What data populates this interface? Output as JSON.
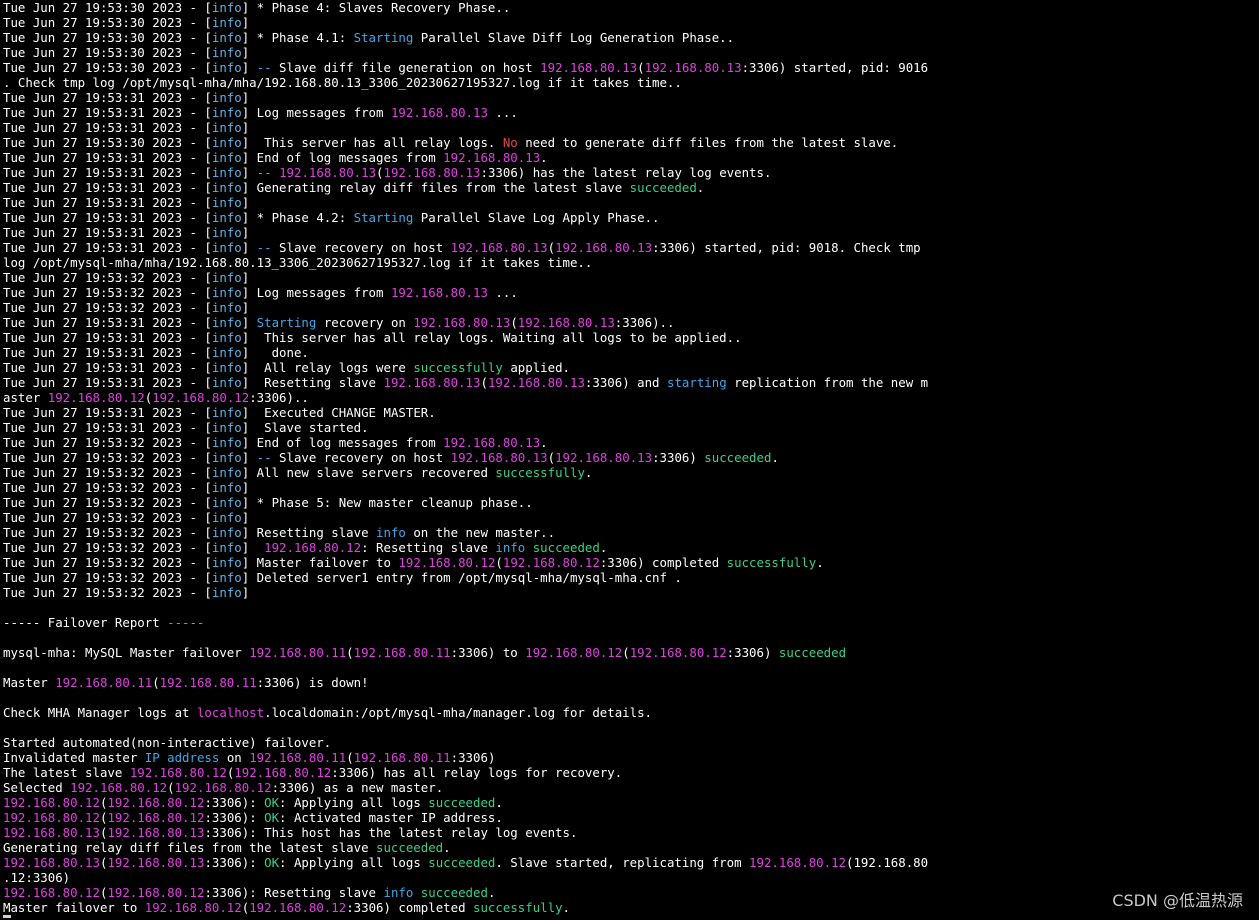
{
  "colors": {
    "default": "#ffffff",
    "m": "#e040e0",
    "g": "#3ccf86",
    "c": "#42a6e8",
    "r": "#e04848",
    "level": "#5fb3e6"
  },
  "watermark": "CSDN @低温热源",
  "lines": [
    {
      "ts": "Tue Jun 27 19:53:30 2023",
      "segs": [
        [
          "w",
          " * Phase 4: Slaves Recovery Phase.."
        ]
      ]
    },
    {
      "ts": "Tue Jun 27 19:53:30 2023",
      "segs": []
    },
    {
      "ts": "Tue Jun 27 19:53:30 2023",
      "segs": [
        [
          "w",
          " * Phase 4.1: "
        ],
        [
          "c",
          "Starting"
        ],
        [
          "w",
          " Parallel Slave Diff Log Generation Phase.."
        ]
      ]
    },
    {
      "ts": "Tue Jun 27 19:53:30 2023",
      "segs": []
    },
    {
      "ts": "Tue Jun 27 19:53:30 2023",
      "segs": [
        [
          "w",
          " "
        ],
        [
          "c",
          "--"
        ],
        [
          "w",
          " Slave diff file generation on host "
        ],
        [
          "m",
          "192.168.80.13"
        ],
        [
          "w",
          "("
        ],
        [
          "m",
          "192.168.80.13"
        ],
        [
          "w",
          ":3306) started, pid: 9016"
        ]
      ]
    },
    {
      "segs": [
        [
          "w",
          ". Check tmp log /opt/mysql-mha/mha/192.168.80.13_3306_20230627195327.log if it takes time.."
        ]
      ]
    },
    {
      "ts": "Tue Jun 27 19:53:31 2023",
      "segs": []
    },
    {
      "ts": "Tue Jun 27 19:53:31 2023",
      "segs": [
        [
          "w",
          " Log messages from "
        ],
        [
          "m",
          "192.168.80.13"
        ],
        [
          "w",
          " ..."
        ]
      ]
    },
    {
      "ts": "Tue Jun 27 19:53:31 2023",
      "segs": []
    },
    {
      "ts": "Tue Jun 27 19:53:30 2023",
      "segs": [
        [
          "w",
          "  This server has all relay logs. "
        ],
        [
          "r",
          "No"
        ],
        [
          "w",
          " need to generate diff files from the latest slave."
        ]
      ]
    },
    {
      "ts": "Tue Jun 27 19:53:31 2023",
      "segs": [
        [
          "w",
          " End of log messages from "
        ],
        [
          "m",
          "192.168.80.13"
        ],
        [
          "w",
          "."
        ]
      ]
    },
    {
      "ts": "Tue Jun 27 19:53:31 2023",
      "segs": [
        [
          "w",
          " "
        ],
        [
          "c",
          "--"
        ],
        [
          "w",
          " "
        ],
        [
          "m",
          "192.168.80.13"
        ],
        [
          "w",
          "("
        ],
        [
          "m",
          "192.168.80.13"
        ],
        [
          "w",
          ":3306) has the latest relay log events."
        ]
      ]
    },
    {
      "ts": "Tue Jun 27 19:53:31 2023",
      "segs": [
        [
          "w",
          " Generating relay diff files from the latest slave "
        ],
        [
          "g",
          "succeeded"
        ],
        [
          "w",
          "."
        ]
      ]
    },
    {
      "ts": "Tue Jun 27 19:53:31 2023",
      "segs": []
    },
    {
      "ts": "Tue Jun 27 19:53:31 2023",
      "segs": [
        [
          "w",
          " * Phase 4.2: "
        ],
        [
          "c",
          "Starting"
        ],
        [
          "w",
          " Parallel Slave Log Apply Phase.."
        ]
      ]
    },
    {
      "ts": "Tue Jun 27 19:53:31 2023",
      "segs": []
    },
    {
      "ts": "Tue Jun 27 19:53:31 2023",
      "segs": [
        [
          "w",
          " "
        ],
        [
          "c",
          "--"
        ],
        [
          "w",
          " Slave recovery on host "
        ],
        [
          "m",
          "192.168.80.13"
        ],
        [
          "w",
          "("
        ],
        [
          "m",
          "192.168.80.13"
        ],
        [
          "w",
          ":3306) started, pid: 9018. Check tmp"
        ]
      ]
    },
    {
      "segs": [
        [
          "w",
          "log /opt/mysql-mha/mha/192.168.80.13_3306_20230627195327.log if it takes time.."
        ]
      ]
    },
    {
      "ts": "Tue Jun 27 19:53:32 2023",
      "segs": []
    },
    {
      "ts": "Tue Jun 27 19:53:32 2023",
      "segs": [
        [
          "w",
          " Log messages from "
        ],
        [
          "m",
          "192.168.80.13"
        ],
        [
          "w",
          " ..."
        ]
      ]
    },
    {
      "ts": "Tue Jun 27 19:53:32 2023",
      "segs": []
    },
    {
      "ts": "Tue Jun 27 19:53:31 2023",
      "segs": [
        [
          "w",
          " "
        ],
        [
          "c",
          "Starting"
        ],
        [
          "w",
          " recovery on "
        ],
        [
          "m",
          "192.168.80.13"
        ],
        [
          "w",
          "("
        ],
        [
          "m",
          "192.168.80.13"
        ],
        [
          "w",
          ":3306).."
        ]
      ]
    },
    {
      "ts": "Tue Jun 27 19:53:31 2023",
      "segs": [
        [
          "w",
          "  This server has all relay logs. Waiting all logs to be applied.."
        ]
      ]
    },
    {
      "ts": "Tue Jun 27 19:53:31 2023",
      "segs": [
        [
          "w",
          "   done."
        ]
      ]
    },
    {
      "ts": "Tue Jun 27 19:53:31 2023",
      "segs": [
        [
          "w",
          "  All relay logs were "
        ],
        [
          "g",
          "successfully"
        ],
        [
          "w",
          " applied."
        ]
      ]
    },
    {
      "ts": "Tue Jun 27 19:53:31 2023",
      "segs": [
        [
          "w",
          "  Resetting slave "
        ],
        [
          "m",
          "192.168.80.13"
        ],
        [
          "w",
          "("
        ],
        [
          "m",
          "192.168.80.13"
        ],
        [
          "w",
          ":3306) and "
        ],
        [
          "c",
          "starting"
        ],
        [
          "w",
          " replication from the new m"
        ]
      ]
    },
    {
      "segs": [
        [
          "w",
          "aster "
        ],
        [
          "m",
          "192.168.80.12"
        ],
        [
          "w",
          "("
        ],
        [
          "m",
          "192.168.80.12"
        ],
        [
          "w",
          ":3306).."
        ]
      ]
    },
    {
      "ts": "Tue Jun 27 19:53:31 2023",
      "segs": [
        [
          "w",
          "  Executed CHANGE MASTER."
        ]
      ]
    },
    {
      "ts": "Tue Jun 27 19:53:31 2023",
      "segs": [
        [
          "w",
          "  Slave started."
        ]
      ]
    },
    {
      "ts": "Tue Jun 27 19:53:32 2023",
      "segs": [
        [
          "w",
          " End of log messages from "
        ],
        [
          "m",
          "192.168.80.13"
        ],
        [
          "w",
          "."
        ]
      ]
    },
    {
      "ts": "Tue Jun 27 19:53:32 2023",
      "segs": [
        [
          "w",
          " "
        ],
        [
          "c",
          "--"
        ],
        [
          "w",
          " Slave recovery on host "
        ],
        [
          "m",
          "192.168.80.13"
        ],
        [
          "w",
          "("
        ],
        [
          "m",
          "192.168.80.13"
        ],
        [
          "w",
          ":3306) "
        ],
        [
          "g",
          "succeeded"
        ],
        [
          "w",
          "."
        ]
      ]
    },
    {
      "ts": "Tue Jun 27 19:53:32 2023",
      "segs": [
        [
          "w",
          " All new slave servers recovered "
        ],
        [
          "g",
          "successfully"
        ],
        [
          "w",
          "."
        ]
      ]
    },
    {
      "ts": "Tue Jun 27 19:53:32 2023",
      "segs": []
    },
    {
      "ts": "Tue Jun 27 19:53:32 2023",
      "segs": [
        [
          "w",
          " * Phase 5: New master cleanup phase.."
        ]
      ]
    },
    {
      "ts": "Tue Jun 27 19:53:32 2023",
      "segs": []
    },
    {
      "ts": "Tue Jun 27 19:53:32 2023",
      "segs": [
        [
          "w",
          " Resetting slave "
        ],
        [
          "c",
          "info"
        ],
        [
          "w",
          " on the new master.."
        ]
      ]
    },
    {
      "ts": "Tue Jun 27 19:53:32 2023",
      "segs": [
        [
          "w",
          "  "
        ],
        [
          "m",
          "192.168.80.12"
        ],
        [
          "w",
          ": Resetting slave "
        ],
        [
          "c",
          "info"
        ],
        [
          "w",
          " "
        ],
        [
          "g",
          "succeeded"
        ],
        [
          "w",
          "."
        ]
      ]
    },
    {
      "ts": "Tue Jun 27 19:53:32 2023",
      "segs": [
        [
          "w",
          " Master failover to "
        ],
        [
          "m",
          "192.168.80.12"
        ],
        [
          "w",
          "("
        ],
        [
          "m",
          "192.168.80.12"
        ],
        [
          "w",
          ":3306) completed "
        ],
        [
          "g",
          "successfully"
        ],
        [
          "w",
          "."
        ]
      ]
    },
    {
      "ts": "Tue Jun 27 19:53:32 2023",
      "segs": [
        [
          "w",
          " Deleted server1 entry from /opt/mysql-mha/mysql-mha.cnf ."
        ]
      ]
    },
    {
      "ts": "Tue Jun 27 19:53:32 2023",
      "segs": []
    },
    {
      "segs": []
    },
    {
      "segs": [
        [
          "w",
          "----- Failover Report "
        ],
        [
          "c",
          "-----"
        ]
      ]
    },
    {
      "segs": []
    },
    {
      "segs": [
        [
          "w",
          "mysql-mha: MySQL Master failover "
        ],
        [
          "m",
          "192.168.80.11"
        ],
        [
          "w",
          "("
        ],
        [
          "m",
          "192.168.80.11"
        ],
        [
          "w",
          ":3306) to "
        ],
        [
          "m",
          "192.168.80.12"
        ],
        [
          "w",
          "("
        ],
        [
          "m",
          "192.168.80.12"
        ],
        [
          "w",
          ":3306) "
        ],
        [
          "g",
          "succeeded"
        ]
      ]
    },
    {
      "segs": []
    },
    {
      "segs": [
        [
          "w",
          "Master "
        ],
        [
          "m",
          "192.168.80.11"
        ],
        [
          "w",
          "("
        ],
        [
          "m",
          "192.168.80.11"
        ],
        [
          "w",
          ":3306) is down!"
        ]
      ]
    },
    {
      "segs": []
    },
    {
      "segs": [
        [
          "w",
          "Check MHA Manager logs at "
        ],
        [
          "m",
          "localhost"
        ],
        [
          "w",
          ".localdomain:/opt/mysql-mha/manager.log for details."
        ]
      ]
    },
    {
      "segs": []
    },
    {
      "segs": [
        [
          "w",
          "Started automated(non-interactive) failover."
        ]
      ]
    },
    {
      "segs": [
        [
          "w",
          "Invalidated master "
        ],
        [
          "c",
          "IP address"
        ],
        [
          "w",
          " on "
        ],
        [
          "m",
          "192.168.80.11"
        ],
        [
          "w",
          "("
        ],
        [
          "m",
          "192.168.80.11"
        ],
        [
          "w",
          ":3306)"
        ]
      ]
    },
    {
      "segs": [
        [
          "w",
          "The latest slave "
        ],
        [
          "m",
          "192.168.80.12"
        ],
        [
          "w",
          "("
        ],
        [
          "m",
          "192.168.80.12"
        ],
        [
          "w",
          ":3306) has all relay logs for recovery."
        ]
      ]
    },
    {
      "segs": [
        [
          "w",
          "Selected "
        ],
        [
          "m",
          "192.168.80.12"
        ],
        [
          "w",
          "("
        ],
        [
          "m",
          "192.168.80.12"
        ],
        [
          "w",
          ":3306) as a new master."
        ]
      ]
    },
    {
      "segs": [
        [
          "m",
          "192.168.80.12"
        ],
        [
          "w",
          "("
        ],
        [
          "m",
          "192.168.80.12"
        ],
        [
          "w",
          ":3306): "
        ],
        [
          "g",
          "OK"
        ],
        [
          "w",
          ": Applying all logs "
        ],
        [
          "g",
          "succeeded"
        ],
        [
          "w",
          "."
        ]
      ]
    },
    {
      "segs": [
        [
          "m",
          "192.168.80.12"
        ],
        [
          "w",
          "("
        ],
        [
          "m",
          "192.168.80.12"
        ],
        [
          "w",
          ":3306): "
        ],
        [
          "g",
          "OK"
        ],
        [
          "w",
          ": Activated master IP address."
        ]
      ]
    },
    {
      "segs": [
        [
          "m",
          "192.168.80.13"
        ],
        [
          "w",
          "("
        ],
        [
          "m",
          "192.168.80.13"
        ],
        [
          "w",
          ":3306): This host has the latest relay log events."
        ]
      ]
    },
    {
      "segs": [
        [
          "w",
          "Generating relay diff files from the latest slave "
        ],
        [
          "g",
          "succeeded"
        ],
        [
          "w",
          "."
        ]
      ]
    },
    {
      "segs": [
        [
          "m",
          "192.168.80.13"
        ],
        [
          "w",
          "("
        ],
        [
          "m",
          "192.168.80.13"
        ],
        [
          "w",
          ":3306): "
        ],
        [
          "g",
          "OK"
        ],
        [
          "w",
          ": Applying all logs "
        ],
        [
          "g",
          "succeeded"
        ],
        [
          "w",
          ". Slave started, replicating from "
        ],
        [
          "m",
          "192.168.80.12"
        ],
        [
          "w",
          "(192.168.80"
        ]
      ]
    },
    {
      "segs": [
        [
          "w",
          ".12:3306)"
        ]
      ]
    },
    {
      "segs": [
        [
          "m",
          "192.168.80.12"
        ],
        [
          "w",
          "("
        ],
        [
          "m",
          "192.168.80.12"
        ],
        [
          "w",
          ":3306): Resetting slave "
        ],
        [
          "c",
          "info"
        ],
        [
          "w",
          " "
        ],
        [
          "g",
          "succeeded"
        ],
        [
          "w",
          "."
        ]
      ]
    },
    {
      "segs": [
        [
          "w",
          "Master failover to "
        ],
        [
          "m",
          "192.168.80.12"
        ],
        [
          "w",
          "("
        ],
        [
          "m",
          "192.168.80.12"
        ],
        [
          "w",
          ":3306) completed "
        ],
        [
          "g",
          "successfully"
        ],
        [
          "w",
          "."
        ]
      ]
    }
  ]
}
